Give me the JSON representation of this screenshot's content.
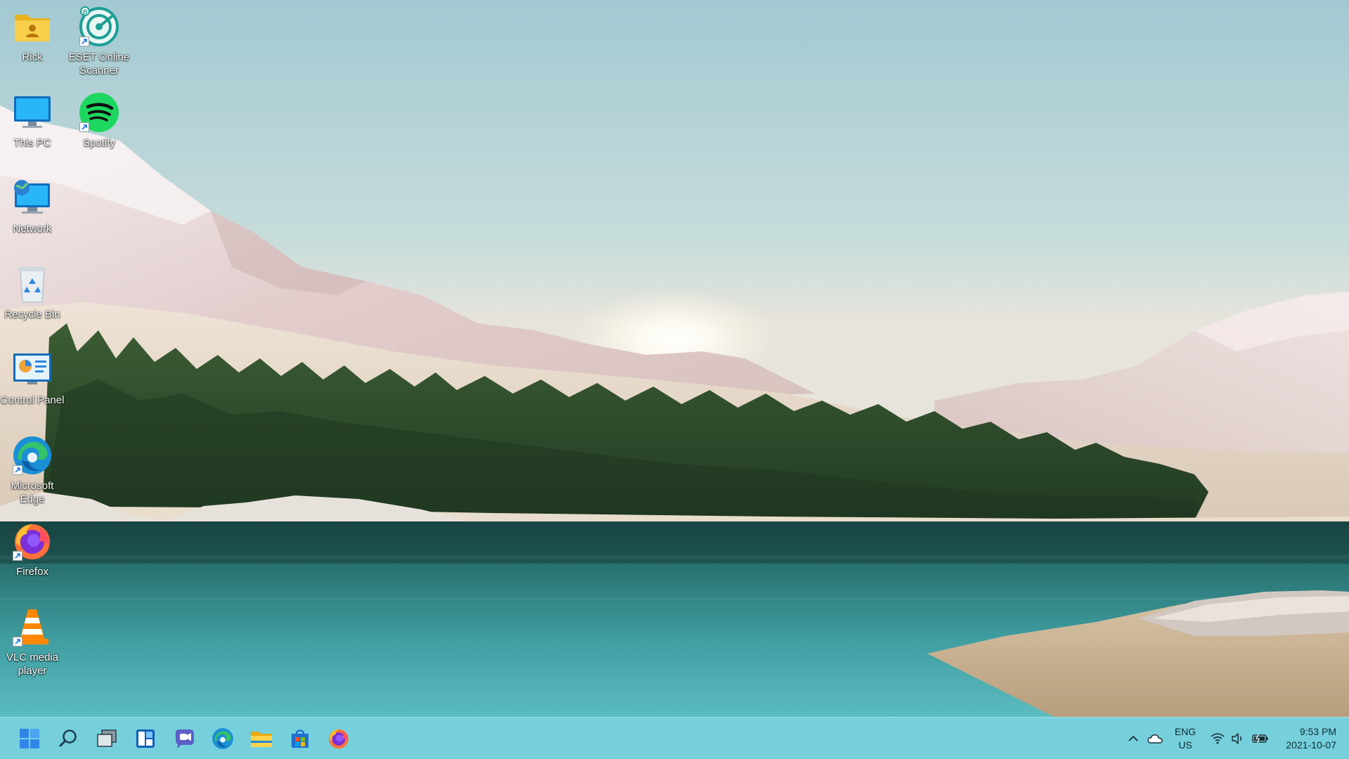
{
  "desktop": {
    "icons": [
      {
        "label": "Rick",
        "icon": "user-folder-icon",
        "shortcut": false
      },
      {
        "label": "ESET Online Scanner",
        "icon": "eset-scanner-icon",
        "shortcut": true
      },
      {
        "label": "This PC",
        "icon": "monitor-icon",
        "shortcut": false
      },
      {
        "label": "Spotify",
        "icon": "spotify-icon",
        "shortcut": true
      },
      {
        "label": "Network",
        "icon": "network-icon",
        "shortcut": false
      },
      {
        "label": "Recycle Bin",
        "icon": "recycle-bin-icon",
        "shortcut": false
      },
      {
        "label": "Control Panel",
        "icon": "control-panel-icon",
        "shortcut": false
      },
      {
        "label": "Microsoft Edge",
        "icon": "edge-icon",
        "shortcut": true
      },
      {
        "label": "Firefox",
        "icon": "firefox-icon",
        "shortcut": true
      },
      {
        "label": "VLC media player",
        "icon": "vlc-icon",
        "shortcut": true
      }
    ]
  },
  "taskbar": {
    "buttons": [
      {
        "name": "start-button",
        "icon": "windows-logo-icon"
      },
      {
        "name": "search-button",
        "icon": "search-icon"
      },
      {
        "name": "task-view-button",
        "icon": "task-view-icon"
      },
      {
        "name": "widgets-button",
        "icon": "widgets-icon"
      },
      {
        "name": "teams-chat-button",
        "icon": "teams-chat-icon"
      },
      {
        "name": "edge-taskbar-button",
        "icon": "edge-icon"
      },
      {
        "name": "file-explorer-button",
        "icon": "folder-icon"
      },
      {
        "name": "microsoft-store-button",
        "icon": "store-icon"
      },
      {
        "name": "firefox-taskbar-button",
        "icon": "firefox-icon"
      }
    ],
    "tray": {
      "overflow_icon": "chevron-up-icon",
      "onedrive_icon": "cloud-icon",
      "language": "ENG",
      "region": "US",
      "wifi_icon": "wifi-icon",
      "volume_icon": "speaker-icon",
      "battery_icon": "battery-icon",
      "time": "9:53 PM",
      "date": "2021-10-07"
    }
  },
  "colors": {
    "taskbar": "#6ccdda",
    "sky": "#a9cfd6",
    "water": "#2f8a8c",
    "forest": "#2f4f2c"
  }
}
